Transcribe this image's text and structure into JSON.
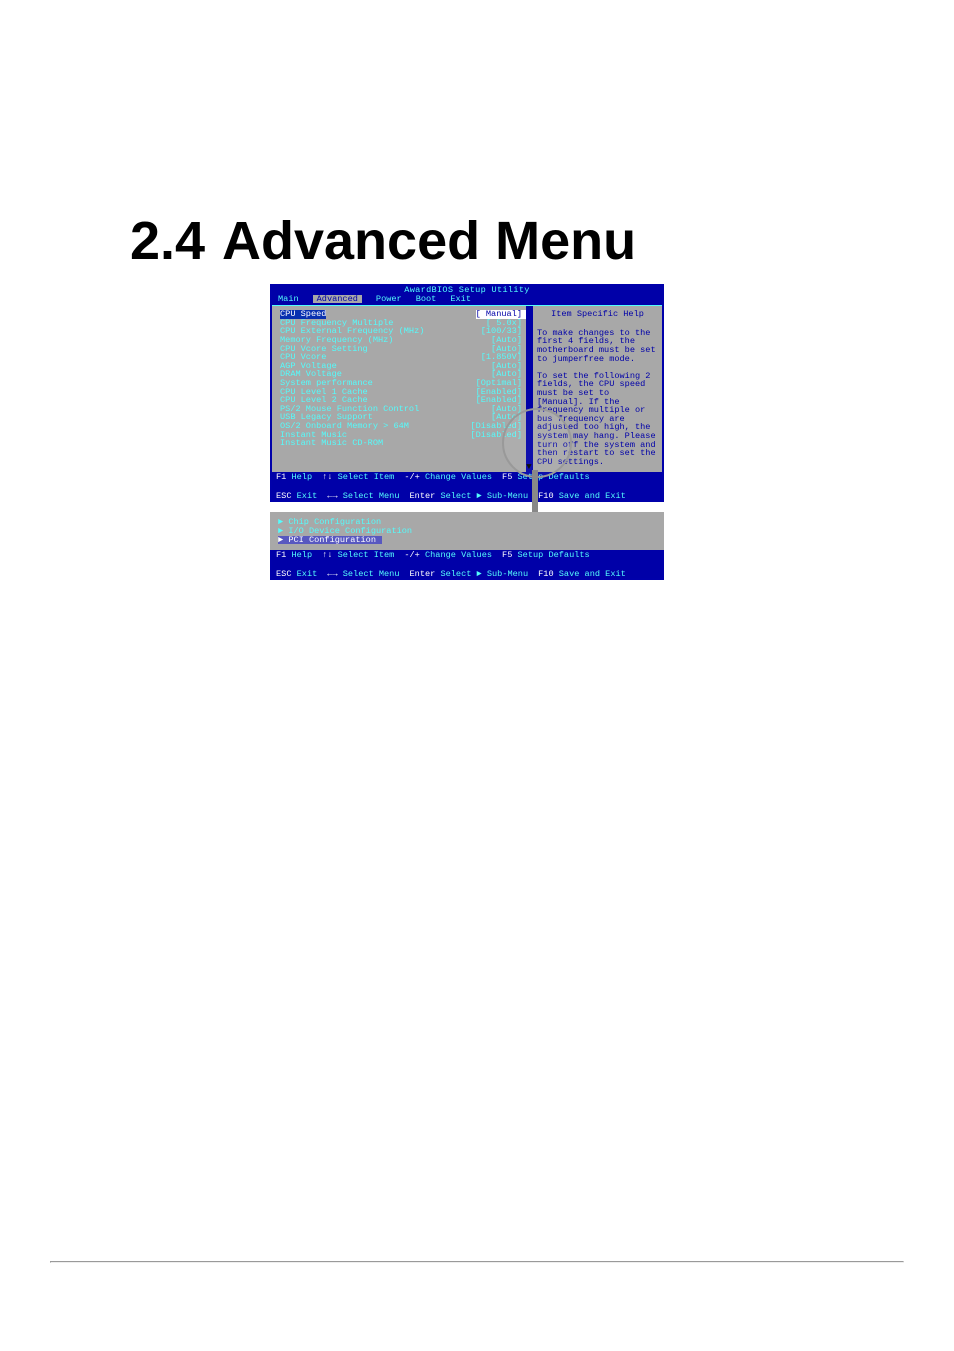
{
  "heading": {
    "section_number": "2.4",
    "title": "Advanced Menu"
  },
  "bios1": {
    "title": "AwardBIOS Setup Utility",
    "menus": {
      "main": "Main",
      "advanced": "Advanced",
      "power": "Power",
      "boot": "Boot",
      "exit": "Exit"
    },
    "help_title": "Item Specific Help",
    "help_text": "To make changes to the first 4 fields, the motherboard must be set to jumperfree mode.\n\nTo set the following 2 fields, the CPU speed must be set to [Manual]. If the frequency multiple or bus frequency are adjusted too high, the system may hang. Please turn off the system and then restart to set the CPU settings.",
    "items": [
      {
        "label": "CPU Speed",
        "value": "[ Manual]",
        "sel": true
      },
      {
        "label": "CPU Frequency Multiple",
        "value": "[ 5.0x]"
      },
      {
        "label": "CPU External Frequency (MHz)",
        "value": "[100/33]"
      },
      {
        "label": "Memory Frequency (MHz)",
        "value": "[Auto]"
      },
      {
        "label": "CPU Vcore Setting",
        "value": "[Auto]"
      },
      {
        "label": "CPU Vcore",
        "value": "[1.850V]"
      },
      {
        "label": "AGP Voltage",
        "value": "[Auto]"
      },
      {
        "label": "DRAM Voltage",
        "value": "[Auto]"
      },
      {
        "label": "System performance",
        "value": "[Optimal]"
      },
      {
        "label": "CPU Level 1 Cache",
        "value": "[Enabled]"
      },
      {
        "label": "CPU Level 2 Cache",
        "value": "[Enabled]"
      },
      {
        "label": "PS/2 Mouse Function Control",
        "value": "[Auto]"
      },
      {
        "label": "USB Legacy Support",
        "value": "[Auto]"
      },
      {
        "label": "OS/2 Onboard Memory > 64M",
        "value": "[Disabled]"
      },
      {
        "label": "Instant Music",
        "value": "[Disabled]"
      },
      {
        "label": "Instant Music CD-ROM",
        "value": ""
      }
    ]
  },
  "footer_keys": {
    "row1": [
      {
        "k": "F1",
        "a": "Help"
      },
      {
        "k": "↑↓",
        "a": "Select Item"
      },
      {
        "k": "-/+",
        "a": "Change Values"
      },
      {
        "k": "F5",
        "a": "Setup Defaults"
      }
    ],
    "row2": [
      {
        "k": "ESC",
        "a": "Exit"
      },
      {
        "k": "←→",
        "a": "Select Menu"
      },
      {
        "k": "Enter",
        "a": "Select ► Sub-Menu"
      },
      {
        "k": "F10",
        "a": "Save and Exit"
      }
    ]
  },
  "sub_items": [
    {
      "label": "► Chip Configuration"
    },
    {
      "label": "► I/O Device Configuration"
    },
    {
      "label": "► PCI Configuration",
      "sel": true
    }
  ]
}
